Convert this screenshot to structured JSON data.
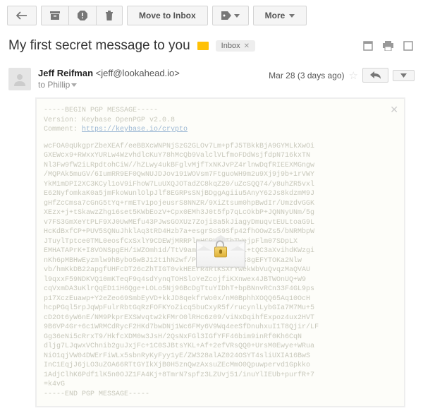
{
  "toolbar": {
    "back_title": "Back",
    "archive_title": "Archive",
    "spam_title": "Report spam",
    "delete_title": "Delete",
    "move_label": "Move to Inbox",
    "labels_title": "Labels",
    "more_label": "More"
  },
  "subject": {
    "text": "My first secret message to you",
    "label": "Inbox",
    "actions": {
      "newwin": "Open in new window",
      "print": "Print",
      "expand": "Expand all"
    }
  },
  "message": {
    "from_name": "Jeff Reifman",
    "from_email": "<jeff@lookahead.io>",
    "to_line": "to Phillip",
    "date": "Mar 28 (3 days ago)",
    "reply_title": "Reply",
    "more_title": "More"
  },
  "pgp": {
    "begin": "-----BEGIN PGP MESSAGE-----",
    "version": "Version: Keybase OpenPGP v2.0.8",
    "comment_label": "Comment: ",
    "comment_link": "https://keybase.io/crypto",
    "end": "-----END PGP MESSAGE-----",
    "lines": [
      "wcFOA0qUkgprZbeXEAf/eeBBXcWNPNjSzG2GLOv7Lm+pfJ5TBkkBjA9GYMLkXwOi",
      "GXEWcx9+RWxxYURLw4WzvhdlcKuY78hMcQb9ValclVLfmoFDdWsjfdpN716kxTN",
      "Nl3Fw9fW2iLRpdtohCiW//hZLwy4ukBFglvMjfTxNKJvPZ4rlnwDqfRIEEXMGngw",
      "/MQPAk5muGV/6IumRR9EF0QwNUJDJov191WOVsm7FtguoWH9m2u9Xj9j9b+1rVWY",
      "YkM1mDPI2XC3KCyl1oV9iFhoW7LuUXQJOTadZC8kqZ20/uZcSQQ74/y8uhZR5vxl",
      "E62NyfomkaK0a5jmFkoWunlOlpJlf8EGRPsSNjBDggAgiiu5AnyY62Js8kdzmM9J",
      "gHfZcCmsa7cGnG5tYq+rmETv1pojeusrS8NNZR/9XiZtsum0hpBwdIr/UmzdvGGK",
      "XEzx+j+tSkawzZhg16set5KWbEozV+Cpx0EMh3J0t5fp7qLcOkbP+JQNNyUNm/5g",
      "v7FS3GmXeYtPLF9XJ0UwMEfu43PJwsGOXUz7Zoji8a5kJiagyDmuqvtEULtoaG9L",
      "HcKdBxfCP+PUV5SQNuJhklAq3tRD4Hzb7a+esgrSoS9Sfp42fhOOwZs5/bNRMbpW",
      "JTuylTptce0TML0eosfCxSxlY9CDEWjMRRPlmHCRH6RTbTWejpFlm07SDpLX",
      "EMHATAPrK+I8VONSpgEH/1WZOmh1d/TtV9amcJb+ZvdOy1KL+tQC3aXvihdKWzgi",
      "nKh6pMBHwEyzmlw9hBybo5wBJ12t1hN2wf/PsdLm+yH55kvs8gEFYTOKa2Nlw",
      "vb/hmKkDB22apgfUHFcDT26cZhTIGT0vkHEErR4RlKSXrYwekWbVuQvqzMaQVAU",
      "l9qxxF59NDKVQ10mKTeqF9q4sdYynqTOHSloYeZcojfiKXnwex4JBTWOnUQ+W9",
      "cqVxmDA3uKlrQqED11H6Qge+LOLo5Nj96BcDgTtuYIDhT+bpBNnvRCn33F4GL9ps",
      "p17XczEuawp+Y2eZeo69SmbEyVD+kkJD8qekfrWo0x/nM0BphhXOQQ65Aq10OcH",
      "hcpPGql5rpJqWpFulrRbtGqRzFOFKYoZicq5buCxyR5f/rucynlLybGIa7M7Mu+5",
      "cD2Ot6yW6nE/NM9PkprEXSWvqtw2kFMrO0lRHc6z09/viNxDqihfExpoz4ux2HVT",
      "9B6VP4Gr+6c1WRMCdRycF2HKd7bwDNj1Wc6FMy6V9Wq4eeSfDnuhxuI1T8Qjir/LF",
      "Gg36eNi5cRrxT9/HkfcXDM0w3JsH/2QsNxFGl3IGfYFF46bim9inRf0Kh6CqN",
      "dljg7LJqwxVChnib2guJxjFc+1C0SJBtsYKL+Af+2efVRsQQ0+UrsM0Ewye+WRua",
      "NiO1qjVW04DWErFiWLx5sbnRyKyFyy1yE/ZW328alAZ024OSYT4sliUXIA16BwS",
      "InC1EqjJ6jLO3uZOA66RTtGYIkXjB0H5znQwzAxsuZEcMmO0Qpuwpervd1Gpkko",
      "1AdjClhK6Pdf1lK5n0OJZ1FA4Kj+8TmrN7spfz3LZUvj51/inuYlIEUb+purfR+7",
      "=k4vG"
    ]
  }
}
